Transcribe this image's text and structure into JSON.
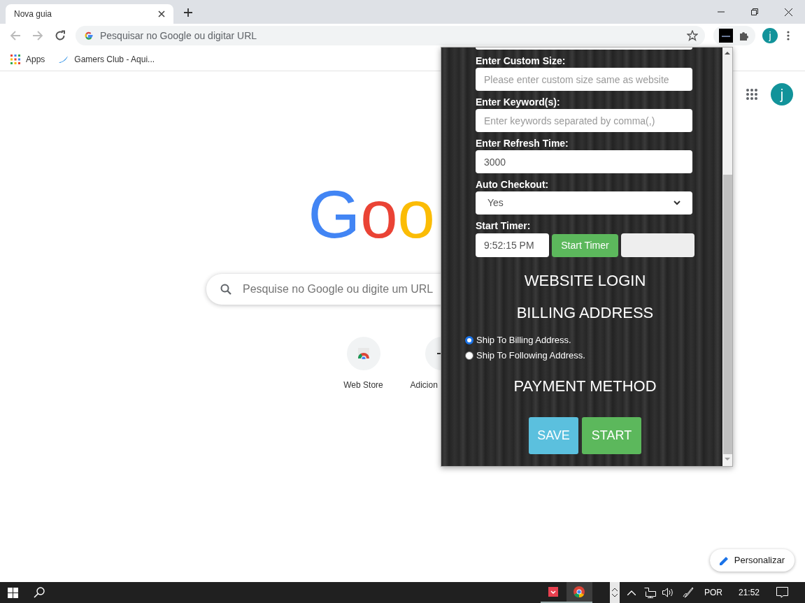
{
  "browser": {
    "tab": {
      "title": "Nova guia"
    },
    "address_bar": {
      "placeholder": "Pesquisar no Google ou digitar URL"
    },
    "bookmarks": [
      {
        "label": "Apps",
        "kind": "apps"
      },
      {
        "label": "Gamers Club - Aqui...",
        "kind": "site"
      }
    ],
    "profile_initial": "j"
  },
  "new_tab_page": {
    "profile_initial": "j",
    "logo": "Goo",
    "search": {
      "placeholder": "Pesquise no Google ou digite um URL"
    },
    "shortcuts": [
      {
        "label": "Web Store",
        "kind": "store"
      },
      {
        "label": "Adicion",
        "kind": "add"
      }
    ],
    "customize_button": "Personalizar"
  },
  "popup": {
    "fields": [
      {
        "kind": "text",
        "label": "Enter Custom Size:",
        "placeholder": "Please enter custom size same as website"
      },
      {
        "kind": "text",
        "label": "Enter Keyword(s):",
        "placeholder": "Enter keywords separated by comma(,)"
      },
      {
        "kind": "text",
        "label": "Enter Refresh Time:",
        "value": "3000"
      },
      {
        "kind": "select",
        "label": "Auto Checkout:",
        "value": "Yes"
      },
      {
        "kind": "timer",
        "label": "Start Timer:",
        "value": "9:52:15 PM",
        "button": "Start Timer"
      }
    ],
    "login_heading": "WEBSITE LOGIN",
    "billing": {
      "heading": "BILLING ADDRESS",
      "options": [
        {
          "label": "Ship To Billing Address.",
          "selected": true
        },
        {
          "label": "Ship To Following Address.",
          "selected": false
        }
      ]
    },
    "payment_heading": "PAYMENT METHOD",
    "buttons": [
      {
        "label": "SAVE",
        "kind": "save"
      },
      {
        "label": "START",
        "kind": "start"
      }
    ]
  },
  "taskbar": {
    "language": "POR",
    "time": "21:52"
  }
}
